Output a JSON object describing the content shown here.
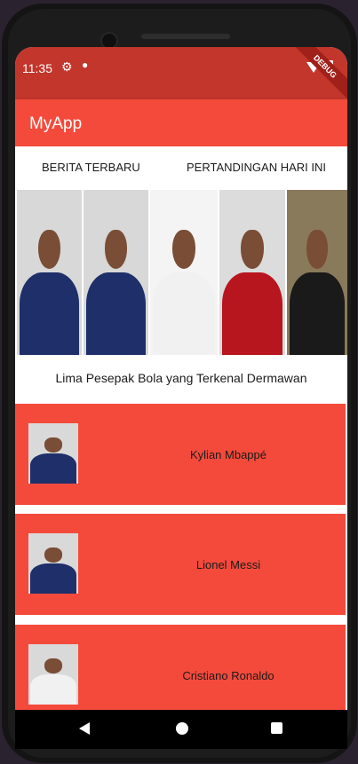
{
  "status_bar": {
    "time": "11:35",
    "debug_label": "DEBUG",
    "icons": [
      "settings-icon",
      "notification-dot-icon",
      "wifi-icon",
      "battery-icon"
    ]
  },
  "app_bar": {
    "title": "MyApp"
  },
  "tabs": [
    {
      "label": "BERITA TERBARU"
    },
    {
      "label": "PERTANDINGAN HARI INI"
    }
  ],
  "banner": {
    "photos": [
      {
        "name": "mbappe-photo",
        "shirt_color": "#1e2f6a",
        "bg": "#d8d8d8"
      },
      {
        "name": "messi-photo",
        "shirt_color": "#1e2f6a",
        "bg": "#d8d8d8"
      },
      {
        "name": "ronaldo-photo",
        "shirt_color": "#f1f1f1",
        "bg": "#f4f4f4"
      },
      {
        "name": "salah-photo",
        "shirt_color": "#b8161f",
        "bg": "#dcdcdc"
      },
      {
        "name": "ozil-photo",
        "shirt_color": "#1a1a1a",
        "bg": "#8a7a5c"
      }
    ]
  },
  "caption": "Lima Pesepak Bola yang Terkenal Dermawan",
  "players": [
    {
      "name": "Kylian Mbappé",
      "shirt_color": "#1e2f6a"
    },
    {
      "name": "Lionel Messi",
      "shirt_color": "#1e2f6a"
    },
    {
      "name": "Cristiano Ronaldo",
      "shirt_color": "#f1f1f1"
    }
  ],
  "colors": {
    "status_bar": "#c2362c",
    "app_bar": "#f44a3b",
    "card": "#f44a3b"
  }
}
